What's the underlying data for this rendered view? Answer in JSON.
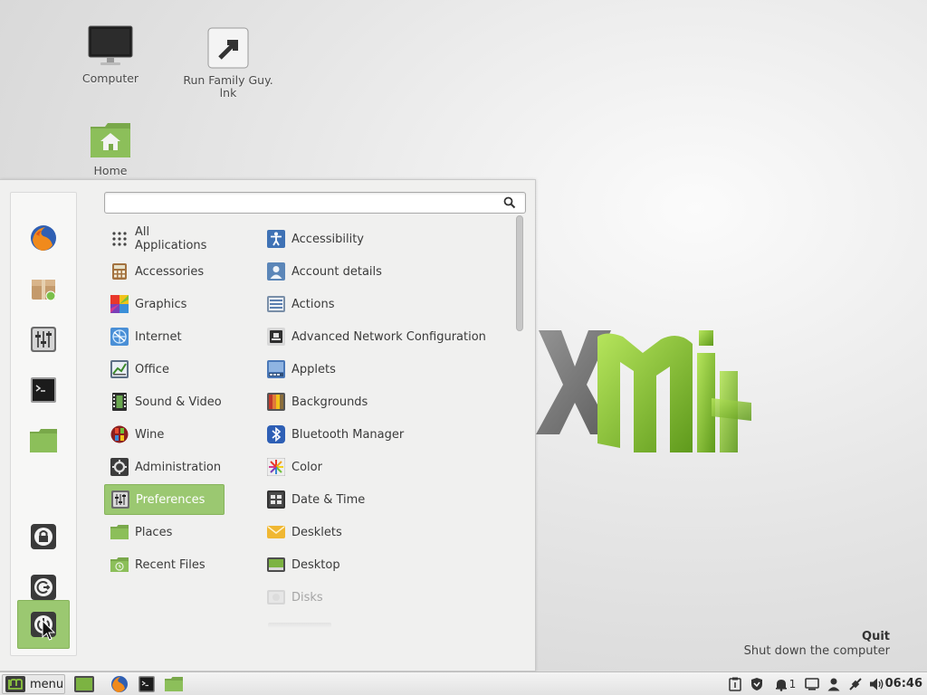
{
  "desktop": {
    "icons": [
      {
        "label": "Computer"
      },
      {
        "label": "Run Family Guy.\nlnk"
      },
      {
        "label": "Home"
      }
    ]
  },
  "menu": {
    "search": {
      "value": "",
      "placeholder": ""
    },
    "categories": [
      {
        "label": "All Applications"
      },
      {
        "label": "Accessories"
      },
      {
        "label": "Graphics"
      },
      {
        "label": "Internet"
      },
      {
        "label": "Office"
      },
      {
        "label": "Sound & Video"
      },
      {
        "label": "Wine"
      },
      {
        "label": "Administration"
      },
      {
        "label": "Preferences"
      },
      {
        "label": "Places"
      },
      {
        "label": "Recent Files"
      }
    ],
    "selected_category": "Preferences",
    "apps": [
      {
        "label": "Accessibility"
      },
      {
        "label": "Account details"
      },
      {
        "label": "Actions"
      },
      {
        "label": "Advanced Network Configuration"
      },
      {
        "label": "Applets"
      },
      {
        "label": "Backgrounds"
      },
      {
        "label": "Bluetooth Manager"
      },
      {
        "label": "Color"
      },
      {
        "label": "Date & Time"
      },
      {
        "label": "Desklets"
      },
      {
        "label": "Desktop"
      },
      {
        "label": "Disks"
      }
    ],
    "favorites": [
      "firefox-icon",
      "software-manager-icon",
      "system-settings-icon",
      "terminal-icon",
      "files-icon"
    ],
    "session_buttons": [
      "lock-screen-icon",
      "logout-icon",
      "shutdown-icon"
    ],
    "hover_info": {
      "title": "Quit",
      "description": "Shut down the computer"
    }
  },
  "taskbar": {
    "menu_label": "menu",
    "clock": "06:46",
    "notification_count": "1",
    "launchers": [
      "show-desktop-icon",
      "firefox-icon",
      "terminal-icon",
      "files-icon"
    ],
    "tray": [
      "clipboard-icon",
      "update-shield-icon",
      "notifications-icon",
      "display-icon",
      "user-icon",
      "network-icon",
      "volume-icon"
    ]
  },
  "colors": {
    "accent": "#9bc871",
    "accent_border": "#86b35b",
    "mint_green": "#8cc63f"
  }
}
